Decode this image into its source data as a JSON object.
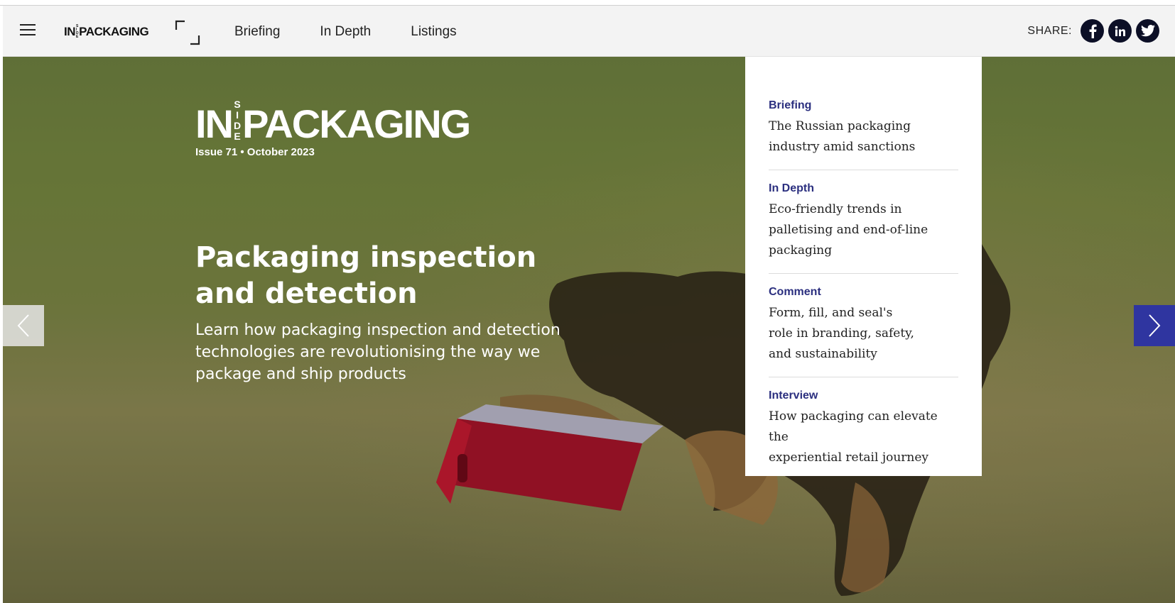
{
  "header": {
    "logo_left": "IN",
    "logo_side": "SIDE",
    "logo_right": "PACKAGING",
    "nav": [
      {
        "label": "Briefing"
      },
      {
        "label": "In Depth"
      },
      {
        "label": "Listings"
      }
    ],
    "share_label": "SHARE:",
    "share_icons": [
      "facebook-icon",
      "linkedin-icon",
      "twitter-icon"
    ]
  },
  "hero": {
    "logo_left": "IN",
    "logo_side": "SIDE",
    "logo_right": "PACKAGING",
    "issue": "Issue 71 • October 2023",
    "headline": "Packaging inspection and detection",
    "subline": "Learn how packaging inspection and detection technologies are revolutionising the way we package and ship products"
  },
  "panel": {
    "items": [
      {
        "category": "Briefing",
        "title": "The Russian packaging\nindustry amid sanctions"
      },
      {
        "category": "In Depth",
        "title": "Eco-friendly trends in\npalletising and end-of-line\npackaging"
      },
      {
        "category": "Comment",
        "title": "Form, fill, and seal's\nrole in branding, safety,\nand sustainability"
      },
      {
        "category": "Interview",
        "title": "How packaging can elevate the\nexperiential retail journey"
      }
    ]
  },
  "colors": {
    "accent": "#2f35a0",
    "category_text": "#2b2f7f",
    "share_button": "#0c0f26",
    "header_bg": "#f3f3f3"
  }
}
